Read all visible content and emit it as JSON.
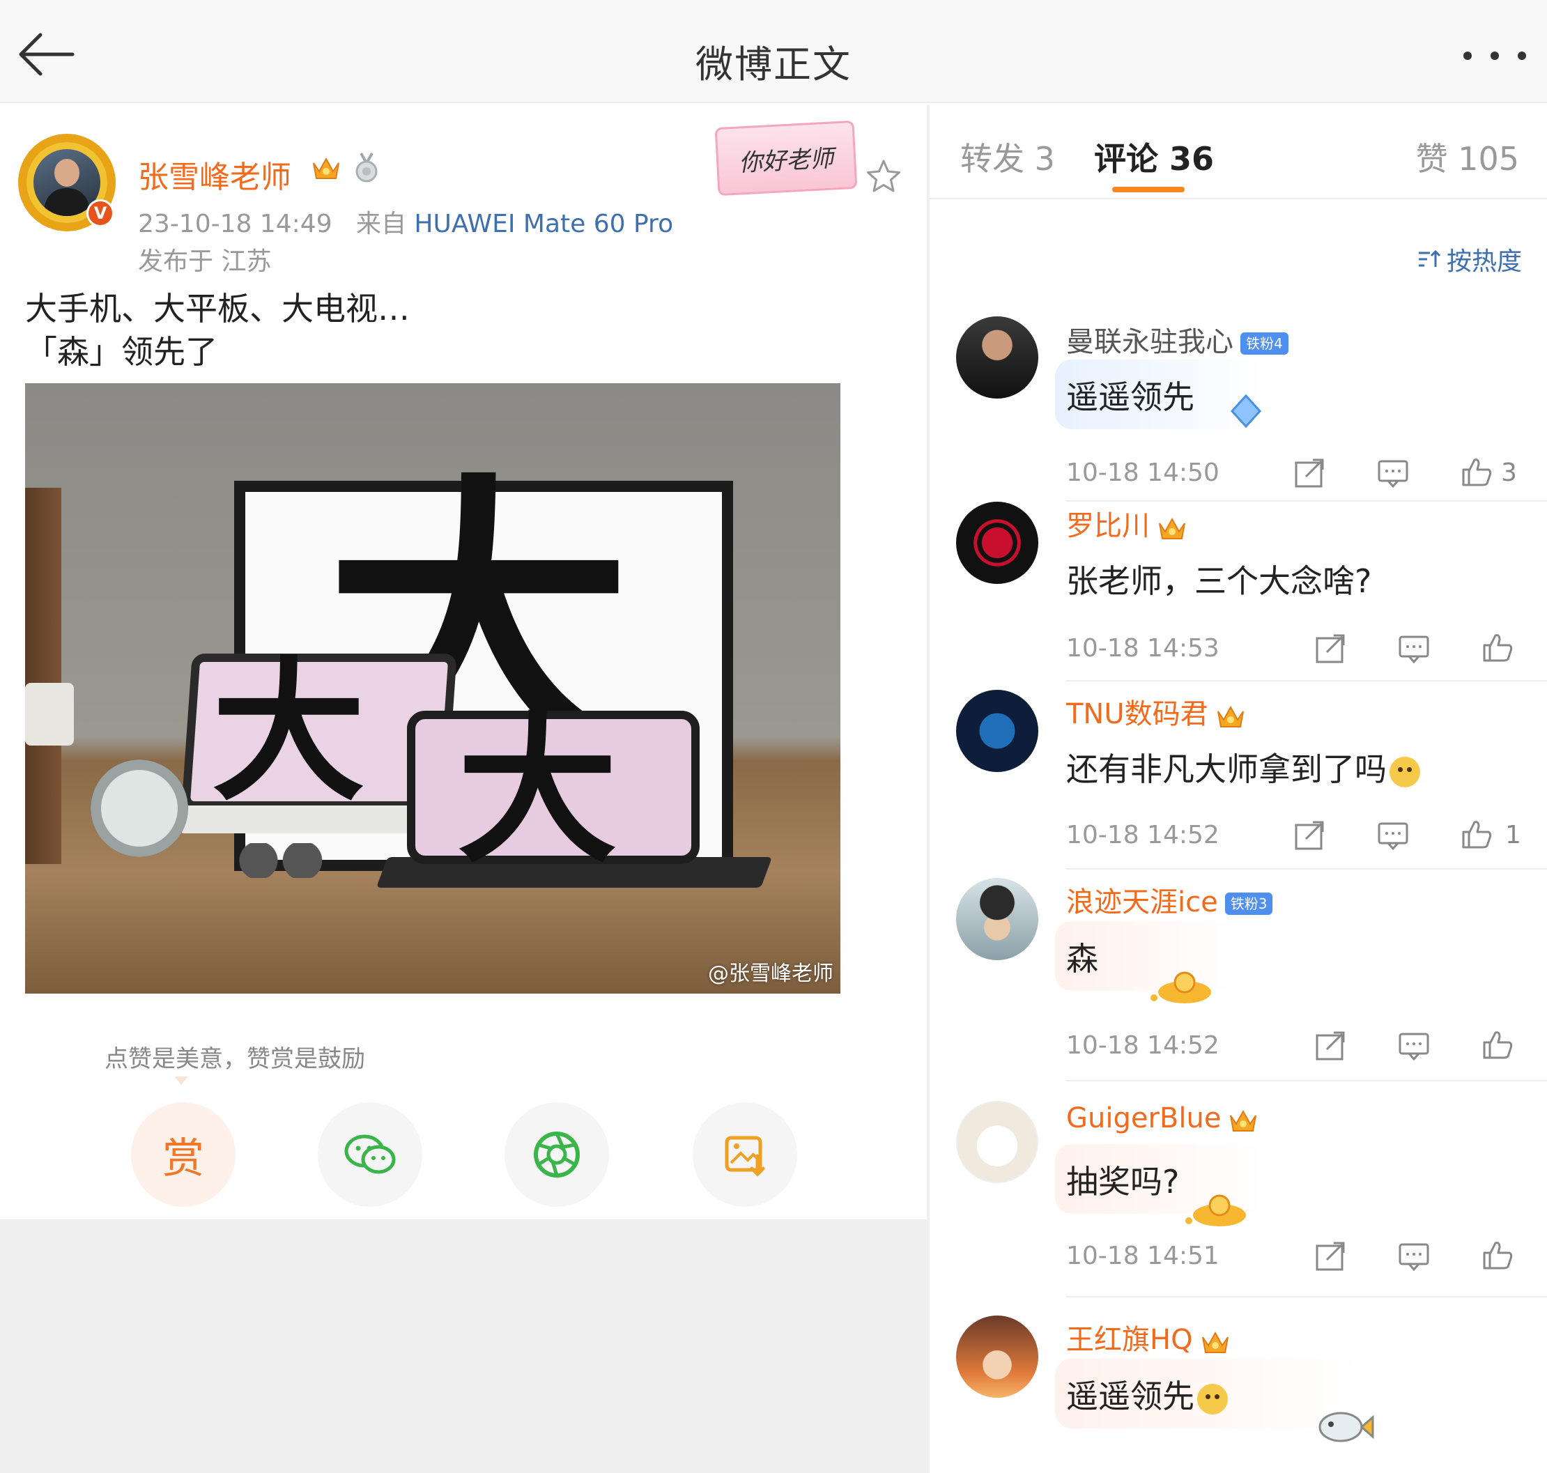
{
  "header": {
    "title": "微博正文"
  },
  "post": {
    "author": "张雪峰老师",
    "time": "23-10-18 14:49",
    "source_prefix": "来自",
    "device": "HUAWEI Mate 60 Pro",
    "location": "发布于 江苏",
    "sticker_text": "你好老师",
    "text": "大手机、大平板、大电视…\n「森」领先了",
    "photo": {
      "chars": [
        "大",
        "大",
        "大"
      ],
      "watermark": "@张雪峰老师"
    },
    "reward_hint": "点赞是美意，赞赏是鼓励",
    "reward_label": "赏"
  },
  "tabs": {
    "repost": "转发 3",
    "comment": "评论 36",
    "like": "赞 105"
  },
  "sort_label": "按热度",
  "comments": [
    {
      "name": "曼联永驻我心",
      "fan_badge": "铁粉4",
      "text": "遥遥领先",
      "time": "10-18 14:50",
      "likes": "3"
    },
    {
      "name": "罗比川",
      "text": "张老师，三个大念啥?",
      "time": "10-18 14:53",
      "likes": ""
    },
    {
      "name": "TNU数码君",
      "text": "还有非凡大师拿到了吗",
      "time": "10-18 14:52",
      "likes": "1"
    },
    {
      "name": "浪迹天涯ice",
      "fan_badge": "铁粉3",
      "text": "森",
      "time": "10-18 14:52",
      "likes": ""
    },
    {
      "name": "GuigerBlue",
      "text": "抽奖吗?",
      "time": "10-18 14:51",
      "likes": ""
    },
    {
      "name": "王红旗HQ",
      "text": "遥遥领先",
      "time": "",
      "likes": ""
    }
  ],
  "colors": {
    "accent": "#f26b1d",
    "link": "#3e6fb0",
    "underline": "#f7861e"
  }
}
